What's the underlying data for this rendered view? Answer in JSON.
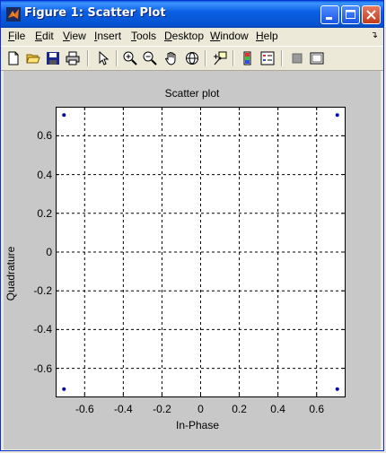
{
  "window": {
    "title": "Figure 1: Scatter Plot"
  },
  "menu": [
    {
      "label_ul": "F",
      "label_rest": "ile"
    },
    {
      "label_ul": "E",
      "label_rest": "dit"
    },
    {
      "label_ul": "V",
      "label_rest": "iew"
    },
    {
      "label_ul": "I",
      "label_rest": "nsert"
    },
    {
      "label_ul": "T",
      "label_rest": "ools"
    },
    {
      "label_ul": "D",
      "label_rest": "esktop"
    },
    {
      "label_ul": "W",
      "label_rest": "indow"
    },
    {
      "label_ul": "H",
      "label_rest": "elp"
    }
  ],
  "toolbar_icons": [
    "new-figure-icon",
    "open-file-icon",
    "save-icon",
    "print-icon",
    "edit-plot-arrow-icon",
    "zoom-in-icon",
    "zoom-out-icon",
    "pan-hand-icon",
    "rotate-3d-icon",
    "data-cursor-icon",
    "colorbar-icon",
    "legend-icon",
    "hide-plot-tools-icon",
    "show-plot-tools-icon"
  ],
  "chart_data": {
    "type": "scatter",
    "title": "Scatter plot",
    "xlabel": "In-Phase",
    "ylabel": "Quadrature",
    "xlim": [
      -0.75,
      0.75
    ],
    "ylim": [
      -0.75,
      0.75
    ],
    "xticks": [
      "-0.6",
      "-0.4",
      "-0.2",
      "0",
      "0.2",
      "0.4",
      "0.6"
    ],
    "yticks": [
      "0.6",
      "0.4",
      "0.2",
      "0",
      "-0.2",
      "-0.4",
      "-0.6"
    ],
    "xtick_values": [
      -0.6,
      -0.4,
      -0.2,
      0,
      0.2,
      0.4,
      0.6
    ],
    "ytick_values": [
      0.6,
      0.4,
      0.2,
      0,
      -0.2,
      -0.4,
      -0.6
    ],
    "grid": true,
    "marker_color": "#0000aa",
    "points": [
      {
        "x": -0.707,
        "y": 0.707
      },
      {
        "x": 0.707,
        "y": 0.707
      },
      {
        "x": -0.707,
        "y": -0.707
      },
      {
        "x": 0.707,
        "y": -0.707
      }
    ]
  }
}
